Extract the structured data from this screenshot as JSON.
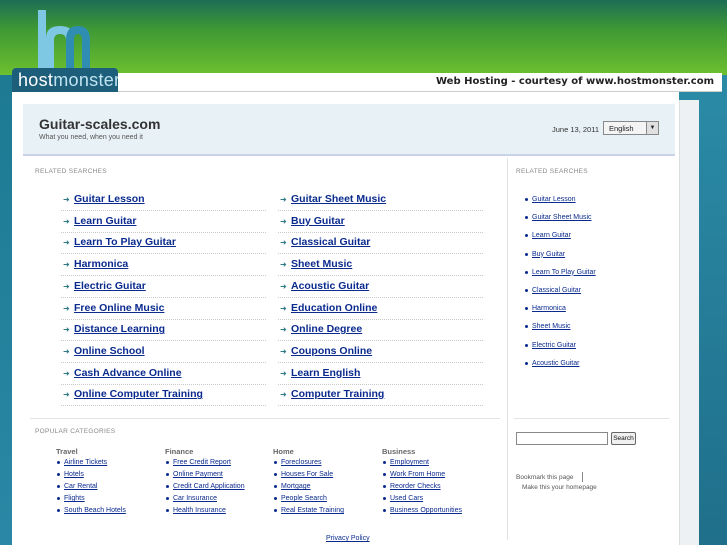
{
  "brand": {
    "logo_text_part1": "host",
    "logo_text_part2": "monster",
    "strip_text": "Web Hosting - courtesy of www.hostmonster.com"
  },
  "header": {
    "title": "Guitar-scales.com",
    "tagline": "What you need, when you need it",
    "date": "June 13, 2011",
    "language": "English"
  },
  "related_label": "RELATED SEARCHES",
  "related_left": [
    "Guitar Lesson",
    "Learn Guitar",
    "Learn To Play Guitar",
    "Harmonica",
    "Electric Guitar",
    "Free Online Music",
    "Distance Learning",
    "Online School",
    "Cash Advance Online",
    "Online Computer Training"
  ],
  "related_right": [
    "Guitar Sheet Music",
    "Buy Guitar",
    "Classical Guitar",
    "Sheet Music",
    "Acoustic Guitar",
    "Education Online",
    "Online Degree",
    "Coupons Online",
    "Learn English",
    "Computer Training"
  ],
  "sidebar": {
    "label": "RELATED SEARCHES",
    "items": [
      "Guitar Lesson",
      "Guitar Sheet Music",
      "Learn Guitar",
      "Buy Guitar",
      "Learn To Play Guitar",
      "Classical Guitar",
      "Harmonica",
      "Sheet Music",
      "Electric Guitar",
      "Acoustic Guitar"
    ],
    "search_button": "Search",
    "bookmark": "Bookmark this page",
    "homepage": "Make this your homepage"
  },
  "popular": {
    "label": "POPULAR CATEGORIES",
    "columns": [
      {
        "head": "Travel",
        "items": [
          "Airline Tickets",
          "Hotels",
          "Car Rental",
          "Flights",
          "South Beach Hotels"
        ]
      },
      {
        "head": "Finance",
        "items": [
          "Free Credit Report",
          "Online Payment",
          "Credit Card Application",
          "Car Insurance",
          "Health Insurance"
        ]
      },
      {
        "head": "Home",
        "items": [
          "Foreclosures",
          "Houses For Sale",
          "Mortgage",
          "People Search",
          "Real Estate Training"
        ]
      },
      {
        "head": "Business",
        "items": [
          "Employment",
          "Work From Home",
          "Reorder Checks",
          "Used Cars",
          "Business Opportunities"
        ]
      }
    ]
  },
  "footer": {
    "privacy": "Privacy Policy"
  }
}
